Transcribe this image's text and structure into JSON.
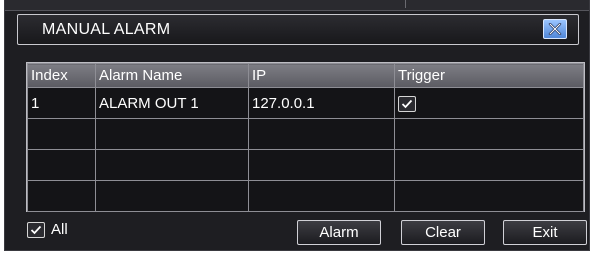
{
  "dialog": {
    "title": "MANUAL ALARM",
    "close_icon": "close-x-icon"
  },
  "table": {
    "columns": [
      "Index",
      "Alarm Name",
      "IP",
      "Trigger"
    ],
    "rows": [
      {
        "index": "1",
        "name": "ALARM OUT 1",
        "ip": "127.0.0.1",
        "trigger": true
      }
    ],
    "empty_rows": 3
  },
  "footer": {
    "all_label": "All",
    "all_checked": true,
    "alarm_label": "Alarm",
    "clear_label": "Clear",
    "exit_label": "Exit"
  },
  "colors": {
    "background": "#1e1e22",
    "header": "#6b6b72",
    "close_button": "#4f86d8"
  }
}
